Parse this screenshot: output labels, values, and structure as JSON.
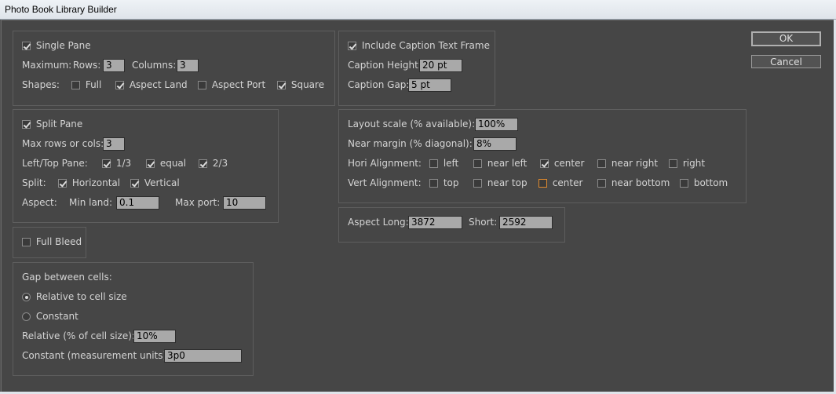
{
  "window": {
    "title": "Photo Book Library Builder"
  },
  "buttons": {
    "ok": "OK",
    "cancel": "Cancel"
  },
  "single_pane": {
    "label": "Single Pane",
    "checked": true,
    "maximum_label": "Maximum:",
    "rows_label": "Rows:",
    "rows": "3",
    "columns_label": "Columns:",
    "columns": "3",
    "shapes_label": "Shapes:",
    "shapes": [
      {
        "label": "Full",
        "checked": false
      },
      {
        "label": "Aspect Land",
        "checked": true
      },
      {
        "label": "Aspect Port",
        "checked": false
      },
      {
        "label": "Square",
        "checked": true
      }
    ]
  },
  "caption": {
    "label": "Include Caption Text Frame",
    "checked": true,
    "height_label": "Caption Height:",
    "height": "20 pt",
    "gap_label": "Caption Gap:",
    "gap": "5 pt"
  },
  "split_pane": {
    "label": "Split Pane",
    "checked": true,
    "max_label": "Max rows or cols:",
    "max": "3",
    "left_top_label": "Left/Top Pane:",
    "left_top": [
      {
        "label": "1/3",
        "checked": true
      },
      {
        "label": "equal",
        "checked": true
      },
      {
        "label": "2/3",
        "checked": true
      }
    ],
    "split_label": "Split:",
    "split": [
      {
        "label": "Horizontal",
        "checked": true
      },
      {
        "label": "Vertical",
        "checked": true
      }
    ],
    "aspect_label": "Aspect:",
    "min_land_label": "Min land:",
    "min_land": "0.1",
    "max_port_label": "Max port:",
    "max_port": "10"
  },
  "layout": {
    "scale_label": "Layout scale (% available):",
    "scale": "100%",
    "margin_label": "Near margin (% diagonal):",
    "margin": "8%",
    "hori_label": "Hori Alignment:",
    "hori": [
      {
        "label": "left",
        "checked": false
      },
      {
        "label": "near left",
        "checked": false
      },
      {
        "label": "center",
        "checked": true
      },
      {
        "label": "near right",
        "checked": false
      },
      {
        "label": "right",
        "checked": false
      }
    ],
    "vert_label": "Vert Alignment:",
    "vert": [
      {
        "label": "top",
        "checked": false
      },
      {
        "label": "near top",
        "checked": false
      },
      {
        "label": "center",
        "checked": false
      },
      {
        "label": "near bottom",
        "checked": false
      },
      {
        "label": "bottom",
        "checked": false
      }
    ]
  },
  "aspect": {
    "long_label": "Aspect Long:",
    "long": "3872",
    "short_label": "Short:",
    "short": "2592"
  },
  "full_bleed": {
    "label": "Full Bleed",
    "checked": false
  },
  "gap": {
    "title": "Gap between cells:",
    "options": [
      {
        "label": "Relative to cell size",
        "selected": true
      },
      {
        "label": "Constant",
        "selected": false
      }
    ],
    "relative_label": "Relative (% of cell size):",
    "relative": "10%",
    "constant_label": "Constant (measurement units):",
    "constant": "3p0"
  }
}
